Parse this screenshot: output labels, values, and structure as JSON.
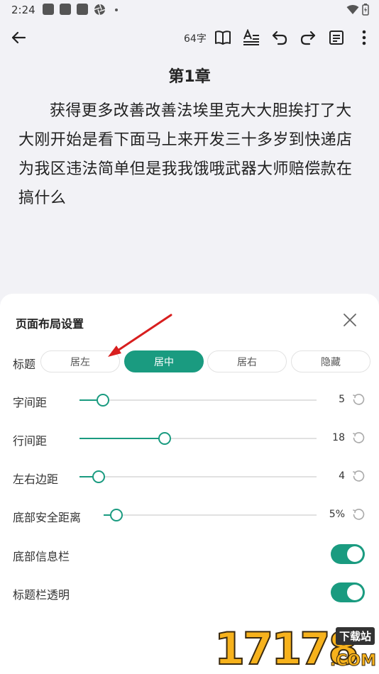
{
  "status_bar": {
    "time": "2:24",
    "icons": [
      "notification-icon",
      "notification-icon",
      "notification-icon",
      "aperture-icon",
      "dot-icon",
      "wifi-icon",
      "battery-icon"
    ]
  },
  "toolbar": {
    "icons": [
      "back-arrow-icon",
      "book-icon",
      "text-format-icon",
      "undo-icon",
      "redo-icon",
      "document-icon",
      "more-vert-icon"
    ],
    "word_count": "64字"
  },
  "chapter": {
    "title": "第1章",
    "body": "获得更多改善改善法埃里克大大胆挨打了大大刚开始是看下面马上来开发三十多岁到快递店为我区违法简单但是我我饿哦武器大师赔偿款在搞什么"
  },
  "sheet": {
    "title": "页面布局设置",
    "title_row": {
      "label": "标题",
      "options": [
        "居左",
        "居中",
        "居右",
        "隐藏"
      ],
      "selected": "居中"
    },
    "sliders": [
      {
        "label": "字间距",
        "value": "5",
        "level": 0.1
      },
      {
        "label": "行间距",
        "value": "18",
        "level": 0.36
      },
      {
        "label": "左右边距",
        "value": "4",
        "level": 0.08
      },
      {
        "label": "底部安全距离",
        "value": "5%",
        "level": 0.05
      }
    ],
    "toggles": [
      {
        "label": "底部信息栏",
        "on": true
      },
      {
        "label": "标题栏透明",
        "on": true
      }
    ]
  },
  "annotation": {
    "arrow_color": "#d81e1e"
  },
  "watermark": {
    "digits": "17178",
    "tag": "下载站",
    "suffix": ".COM"
  },
  "colors": {
    "accent": "#1a9b80",
    "background": "#f2f2f6",
    "sheet": "#ffffff"
  }
}
